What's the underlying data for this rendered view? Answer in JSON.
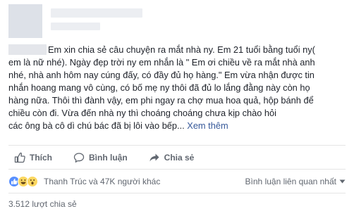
{
  "post": {
    "text_lines": [
      "Em xin chia sẻ câu chuyện ra mắt nhà ny. Em 21 tuổi bằng tuổi ny(",
      "em là nữ nhé). Ngày đẹp trời ny em nhắn là \" Em ơi chiều về ra mắt nhà anh",
      "nhé, nhà anh hôm nay cúng đấy, có đầy đủ họ hàng.\" Em vừa nhận được tin",
      "nhắn hoang mang vô cùng, có bố mẹ ny thôi đã đủ lo lắng đằng này còn họ",
      "hàng nữa. Thôi thì đành vậy, em phi ngay ra chợ mua hoa quả, hộp bánh để",
      "chiều còn đi. Vừa đến nhà ny thì choáng choáng chưa kịp chào hỏi",
      "các ông bà cô dì chú bác đã bị lôi vào bếp..."
    ],
    "see_more": "Xem thêm"
  },
  "actions": {
    "like": "Thích",
    "comment": "Bình luận",
    "share": "Chia sẻ"
  },
  "reactions": {
    "icons": [
      "like-icon",
      "haha-icon",
      "wow-icon"
    ],
    "summary": "Thanh Trúc và 47K người khác",
    "sort_label": "Bình luận liên quan nhất"
  },
  "shares": "3.512 lượt chia sẻ",
  "colors": {
    "link": "#365899",
    "secondary": "#616770",
    "like_blue": "#5890ff",
    "emoji_yellow": "#fcd760"
  }
}
